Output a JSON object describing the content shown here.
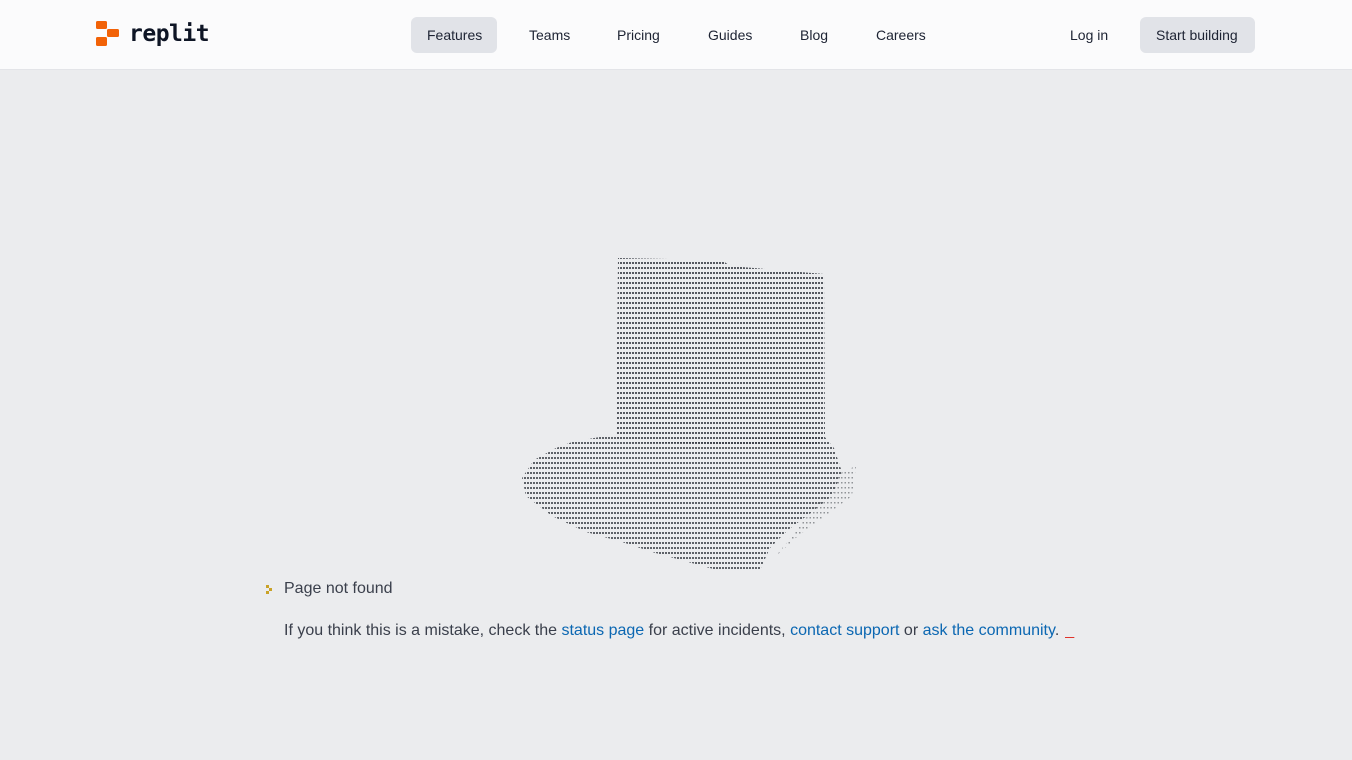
{
  "brand": {
    "name": "replit",
    "logo_color": "#f26207"
  },
  "nav": {
    "items": [
      {
        "label": "Features",
        "active": true
      },
      {
        "label": "Teams"
      },
      {
        "label": "Pricing"
      },
      {
        "label": "Guides"
      },
      {
        "label": "Blog"
      },
      {
        "label": "Careers"
      }
    ],
    "login_label": "Log in",
    "start_label": "Start building"
  },
  "error": {
    "title": "Page not found",
    "prefix": "If you think this is a mistake, check the",
    "status_link": "status page",
    "middle": "for active incidents,",
    "support_link": "contact support",
    "or_text": "or",
    "community_link": "ask the community",
    "suffix": ".",
    "cursor": "_"
  },
  "illustration": {
    "icon": "ascii-art-hat-icon"
  }
}
